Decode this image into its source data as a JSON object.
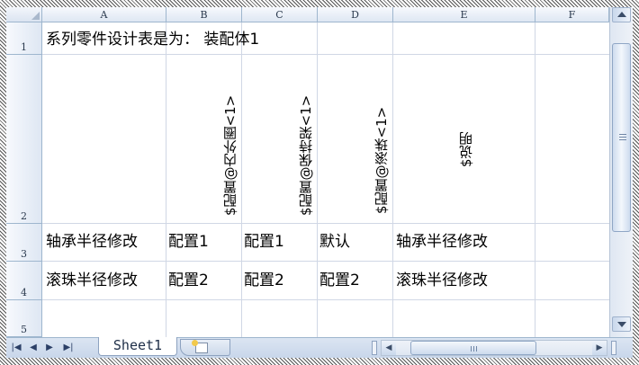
{
  "columns": [
    "A",
    "B",
    "C",
    "D",
    "E",
    "F"
  ],
  "rows": [
    "1",
    "2",
    "3",
    "4",
    "5"
  ],
  "cells": {
    "A1": "系列零件设计表是为：  装配体1",
    "B2": "$配置@内外圈<1>",
    "C2": "$配置@保持架<1>",
    "D2": "$配置@滚珠<1>",
    "E2": "$说明",
    "A3": "轴承半径修改",
    "B3": "配置1",
    "C3": "配置1",
    "D3": "默认",
    "E3": "轴承半径修改",
    "A4": "滚珠半径修改",
    "B4": "配置2",
    "C4": "配置2",
    "D4": "配置2",
    "E4": "滚珠半径修改"
  },
  "tabs": {
    "sheet1": "Sheet1",
    "nav_first": "|◀",
    "nav_prev": "◀",
    "nav_next": "▶",
    "nav_last": "▶|"
  },
  "icons": {
    "nav_first": "first-sheet-icon",
    "nav_prev": "prev-sheet-icon",
    "nav_next": "next-sheet-icon",
    "nav_last": "last-sheet-icon",
    "insert_sheet": "insert-worksheet-icon"
  },
  "colors": {
    "header_bg": "#dee7f3",
    "gridline": "#d0d7e5",
    "header_border": "#9eb6ce"
  }
}
